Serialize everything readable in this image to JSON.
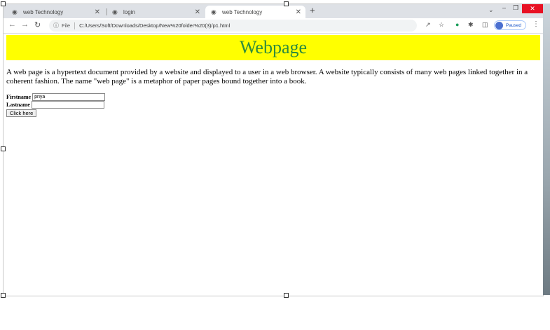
{
  "tabs": [
    {
      "label": "web Technology",
      "active": false
    },
    {
      "label": "login",
      "active": false
    },
    {
      "label": "web Technology",
      "active": true
    }
  ],
  "address": {
    "file_label": "File",
    "url": "C:/Users/Soft/Downloads/Desktop/New%20folder%20(3)/p1.html"
  },
  "profile": {
    "status": "Paused"
  },
  "page": {
    "heading": "Webpage",
    "paragraph": "A web page is a hypertext document provided by a website and displayed to a user in a web browser. A website typically consists of many web pages linked together in a coherent fashion. The name \"web page\" is a metaphor of paper pages bound together into a book.",
    "form": {
      "firstname_label": "Firstname",
      "firstname_value": "priya",
      "lastname_label": "Lastname",
      "lastname_value": "",
      "submit_label": "Click here"
    }
  },
  "colors": {
    "banner_bg": "#ffff00",
    "heading_color": "#2e8b3e"
  }
}
